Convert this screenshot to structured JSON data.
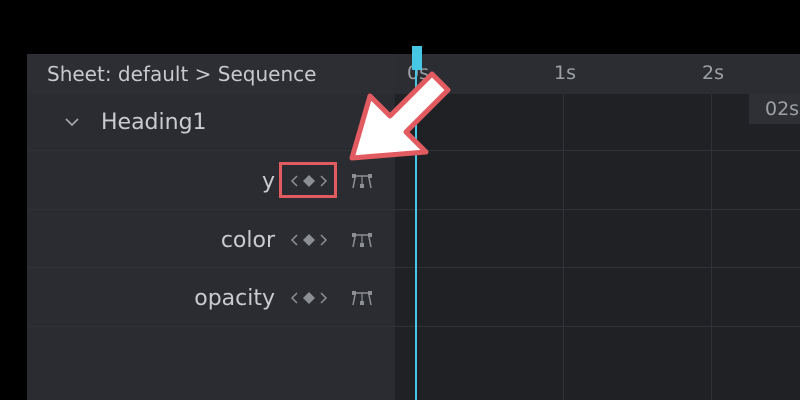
{
  "header": {
    "breadcrumb": "Sheet: default > Sequence"
  },
  "timeline": {
    "ticks": [
      "0s",
      "1s",
      "2s"
    ],
    "time_box": "02s"
  },
  "tree": {
    "object_name": "Heading1",
    "properties": [
      {
        "label": "y"
      },
      {
        "label": "color"
      },
      {
        "label": "opacity"
      }
    ]
  },
  "colors": {
    "playhead": "#46c8e4",
    "annotation": "#e25b60"
  },
  "icons": {
    "expand": "chevron-down-icon",
    "keyframe_nav": "keyframe-nav-icon",
    "graph_editor": "graph-editor-icon"
  }
}
